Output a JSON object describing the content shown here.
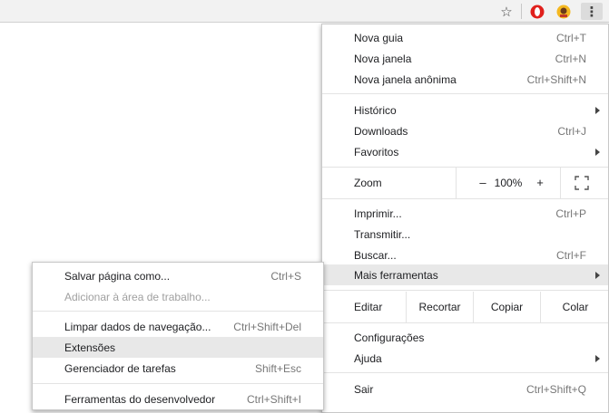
{
  "main_menu": {
    "new_tab": {
      "label": "Nova guia",
      "shortcut": "Ctrl+T"
    },
    "new_window": {
      "label": "Nova janela",
      "shortcut": "Ctrl+N"
    },
    "incognito": {
      "label": "Nova janela anônima",
      "shortcut": "Ctrl+Shift+N"
    },
    "history": {
      "label": "Histórico"
    },
    "downloads": {
      "label": "Downloads",
      "shortcut": "Ctrl+J"
    },
    "bookmarks": {
      "label": "Favoritos"
    },
    "zoom": {
      "label": "Zoom",
      "minus": "–",
      "value": "100%",
      "plus": "+"
    },
    "print": {
      "label": "Imprimir...",
      "shortcut": "Ctrl+P"
    },
    "cast": {
      "label": "Transmitir..."
    },
    "find": {
      "label": "Buscar...",
      "shortcut": "Ctrl+F"
    },
    "more_tools": {
      "label": "Mais ferramentas"
    },
    "edit": {
      "label": "Editar",
      "cut": "Recortar",
      "copy": "Copiar",
      "paste": "Colar"
    },
    "settings": {
      "label": "Configurações"
    },
    "help": {
      "label": "Ajuda"
    },
    "exit": {
      "label": "Sair",
      "shortcut": "Ctrl+Shift+Q"
    }
  },
  "sub_menu": {
    "save_page": {
      "label": "Salvar página como...",
      "shortcut": "Ctrl+S"
    },
    "add_desktop": {
      "label": "Adicionar à área de trabalho..."
    },
    "clear_data": {
      "label": "Limpar dados de navegação...",
      "shortcut": "Ctrl+Shift+Del"
    },
    "extensions": {
      "label": "Extensões"
    },
    "task_manager": {
      "label": "Gerenciador de tarefas",
      "shortcut": "Shift+Esc"
    },
    "dev_tools": {
      "label": "Ferramentas do desenvolvedor",
      "shortcut": "Ctrl+Shift+I"
    }
  },
  "toolbar": {
    "star_icon": "star-icon",
    "opera_icon": "opera-icon",
    "extension_icon": "extension-icon",
    "menu_icon": "kebab-menu-icon"
  },
  "colors": {
    "highlight": "#e8e8e8",
    "opera_red": "#e0201c",
    "toolbar_bg": "#f2f2f2"
  }
}
